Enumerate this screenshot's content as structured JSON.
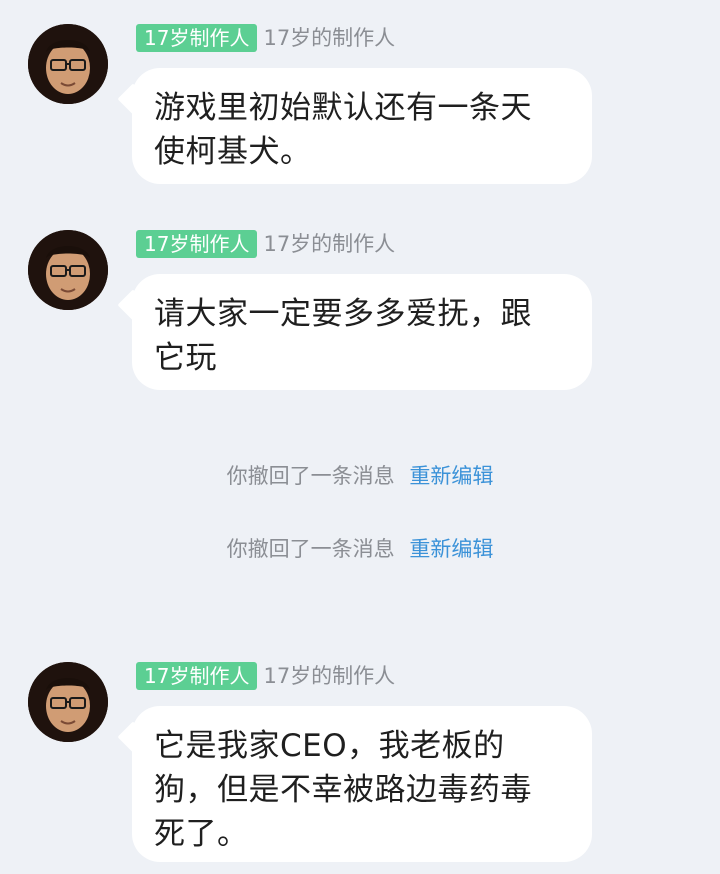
{
  "messages": [
    {
      "sender_tag": "17岁制作人",
      "sender_name": "17岁的制作人",
      "text": "游戏里初始默认还有一条天\n使柯基犬。"
    },
    {
      "sender_tag": "17岁制作人",
      "sender_name": "17岁的制作人",
      "text": "请大家一定要多多爱抚，跟\n它玩"
    },
    {
      "sender_tag": "17岁制作人",
      "sender_name": "17岁的制作人",
      "text": "它是我家CEO，我老板的\n狗，但是不幸被路边毒药毒\n死了。"
    }
  ],
  "system_notices": [
    {
      "text": "你撤回了一条消息",
      "action": "重新编辑"
    },
    {
      "text": "你撤回了一条消息",
      "action": "重新编辑"
    }
  ],
  "colors": {
    "background": "#eef1f6",
    "bubble": "#ffffff",
    "tag": "#5ccf93",
    "muted_text": "#8b8e94",
    "link": "#3b92d8"
  },
  "icons": {
    "avatar": "user-avatar-photo"
  }
}
